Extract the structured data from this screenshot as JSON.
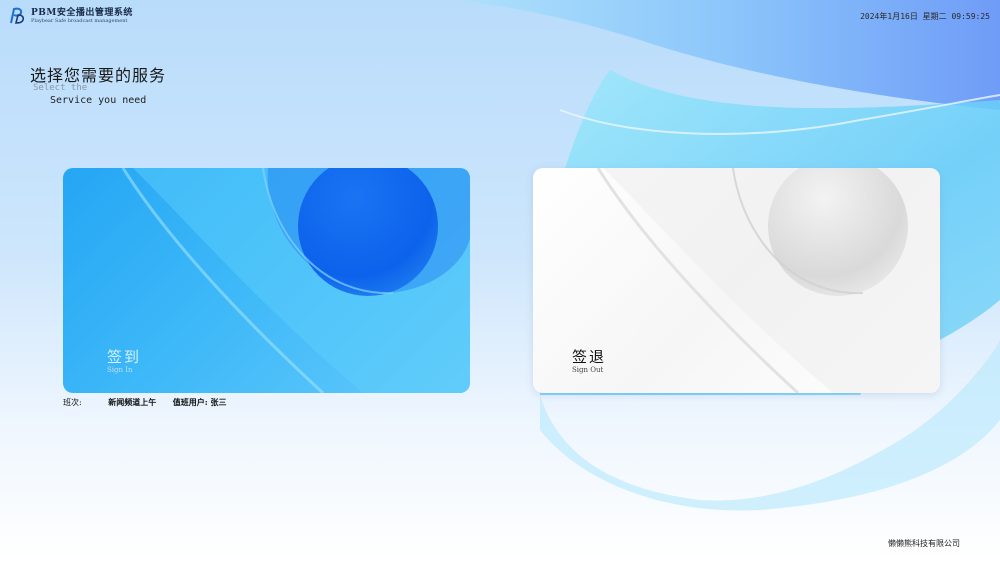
{
  "header": {
    "logo_title": "PBM安全播出管理系统",
    "logo_subtitle": "Playbear Safe broadcast management",
    "datetime": "2024年1月16日 星期二 09:59:25"
  },
  "heading": {
    "title_cn": "选择您需要的服务",
    "title_en_line1": "Select the",
    "title_en_line2": "Service you need"
  },
  "cards": {
    "sign_in": {
      "title": "签到",
      "subtitle": "Sign In"
    },
    "sign_out": {
      "title": "签退",
      "subtitle": "Sign Out"
    }
  },
  "shift": {
    "label": "班次:",
    "value": "新闻频道上午",
    "duty_user": "值班用户: 张三"
  },
  "footer": {
    "company": "懒懒熊科技有限公司"
  },
  "colors": {
    "sign_in_card": "#25a6f4",
    "sign_out_card": "#ffffff",
    "accent": "#1a6cf0"
  }
}
